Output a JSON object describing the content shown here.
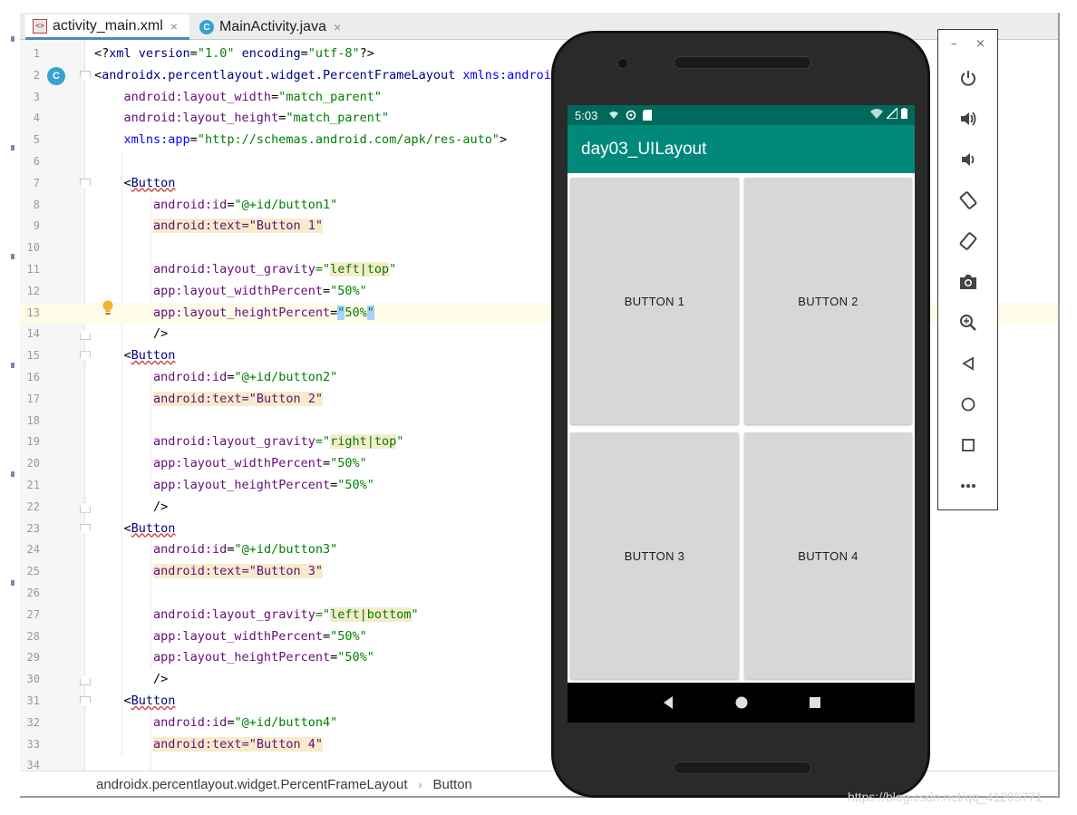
{
  "tabs": [
    {
      "label": "activity_main.xml",
      "icon": "xml-file-icon",
      "active": true
    },
    {
      "label": "MainActivity.java",
      "icon": "java-class-icon",
      "active": false
    }
  ],
  "gutter": {
    "class_marker": "C"
  },
  "code_lines": [
    {
      "n": "1",
      "tokens": [
        {
          "t": "<?",
          "c": "t-punc"
        },
        {
          "t": "xml version",
          "c": "t-tag"
        },
        {
          "t": "=",
          "c": "t-punc"
        },
        {
          "t": "\"1.0\"",
          "c": "t-val"
        },
        {
          "t": " encoding",
          "c": "t-tag"
        },
        {
          "t": "=",
          "c": "t-punc"
        },
        {
          "t": "\"utf-8\"",
          "c": "t-val"
        },
        {
          "t": "?>",
          "c": "t-punc"
        }
      ]
    },
    {
      "n": "2",
      "tokens": [
        {
          "t": "<",
          "c": "t-punc"
        },
        {
          "t": "androidx.percentlayout.widget.PercentFrameLayout",
          "c": "t-tag"
        },
        {
          "t": " xmlns:android",
          "c": "t-attr"
        }
      ]
    },
    {
      "n": "3",
      "tokens": [
        {
          "t": "    android:layout_width",
          "c": "t-attrp"
        },
        {
          "t": "=",
          "c": "t-punc"
        },
        {
          "t": "\"match_parent\"",
          "c": "t-val"
        }
      ]
    },
    {
      "n": "4",
      "tokens": [
        {
          "t": "    android:layout_height",
          "c": "t-attrp"
        },
        {
          "t": "=",
          "c": "t-punc"
        },
        {
          "t": "\"match_parent\"",
          "c": "t-val"
        }
      ]
    },
    {
      "n": "5",
      "tokens": [
        {
          "t": "    xmlns:app",
          "c": "t-attr"
        },
        {
          "t": "=",
          "c": "t-punc"
        },
        {
          "t": "\"http://schemas.android.com/apk/res-auto\"",
          "c": "t-val"
        },
        {
          "t": ">",
          "c": "t-punc"
        }
      ]
    },
    {
      "n": "6",
      "tokens": []
    },
    {
      "n": "7",
      "tokens": [
        {
          "t": "    <",
          "c": "t-punc"
        },
        {
          "t": "Button",
          "c": "t-tag sq"
        }
      ]
    },
    {
      "n": "8",
      "tokens": [
        {
          "t": "        android:id",
          "c": "t-attrp"
        },
        {
          "t": "=",
          "c": "t-punc"
        },
        {
          "t": "\"@+id/button1\"",
          "c": "t-val"
        }
      ]
    },
    {
      "n": "9",
      "tokens": [
        {
          "t": "        ",
          "c": "t-punc"
        },
        {
          "t": "android:text=\"Button 1\"",
          "c": "t-attrp hl"
        }
      ]
    },
    {
      "n": "10",
      "tokens": []
    },
    {
      "n": "11",
      "tokens": [
        {
          "t": "        android:layout_gravity",
          "c": "t-attrp"
        },
        {
          "t": "=\"",
          "c": "t-val"
        },
        {
          "t": "left|top",
          "c": "t-val hl"
        },
        {
          "t": "\"",
          "c": "t-val"
        }
      ]
    },
    {
      "n": "12",
      "tokens": [
        {
          "t": "        app:layout_widthPercent",
          "c": "t-attrp"
        },
        {
          "t": "=",
          "c": "t-punc"
        },
        {
          "t": "\"50%\"",
          "c": "t-val"
        }
      ]
    },
    {
      "n": "13",
      "tokens": [
        {
          "t": "        app:layout_heightPercent",
          "c": "t-attrp"
        },
        {
          "t": "=",
          "c": "t-punc"
        },
        {
          "t": "\"",
          "c": "t-val sel"
        },
        {
          "t": "50%",
          "c": "t-val"
        },
        {
          "t": "\"",
          "c": "t-val sel"
        }
      ],
      "current": true
    },
    {
      "n": "14",
      "tokens": [
        {
          "t": "        />",
          "c": "t-punc"
        }
      ]
    },
    {
      "n": "15",
      "tokens": [
        {
          "t": "    <",
          "c": "t-punc"
        },
        {
          "t": "Button",
          "c": "t-tag sq"
        }
      ]
    },
    {
      "n": "16",
      "tokens": [
        {
          "t": "        android:id",
          "c": "t-attrp"
        },
        {
          "t": "=",
          "c": "t-punc"
        },
        {
          "t": "\"@+id/button2\"",
          "c": "t-val"
        }
      ]
    },
    {
      "n": "17",
      "tokens": [
        {
          "t": "        ",
          "c": "t-punc"
        },
        {
          "t": "android:text=\"Button 2\"",
          "c": "t-attrp hl"
        }
      ]
    },
    {
      "n": "18",
      "tokens": []
    },
    {
      "n": "19",
      "tokens": [
        {
          "t": "        android:layout_gravity",
          "c": "t-attrp"
        },
        {
          "t": "=\"",
          "c": "t-val"
        },
        {
          "t": "right|top",
          "c": "t-val hl"
        },
        {
          "t": "\"",
          "c": "t-val"
        }
      ]
    },
    {
      "n": "20",
      "tokens": [
        {
          "t": "        app:layout_widthPercent",
          "c": "t-attrp"
        },
        {
          "t": "=",
          "c": "t-punc"
        },
        {
          "t": "\"50%\"",
          "c": "t-val"
        }
      ]
    },
    {
      "n": "21",
      "tokens": [
        {
          "t": "        app:layout_heightPercent",
          "c": "t-attrp"
        },
        {
          "t": "=",
          "c": "t-punc"
        },
        {
          "t": "\"50%\"",
          "c": "t-val"
        }
      ]
    },
    {
      "n": "22",
      "tokens": [
        {
          "t": "        />",
          "c": "t-punc"
        }
      ]
    },
    {
      "n": "23",
      "tokens": [
        {
          "t": "    <",
          "c": "t-punc"
        },
        {
          "t": "Button",
          "c": "t-tag sq"
        }
      ]
    },
    {
      "n": "24",
      "tokens": [
        {
          "t": "        android:id",
          "c": "t-attrp"
        },
        {
          "t": "=",
          "c": "t-punc"
        },
        {
          "t": "\"@+id/button3\"",
          "c": "t-val"
        }
      ]
    },
    {
      "n": "25",
      "tokens": [
        {
          "t": "        ",
          "c": "t-punc"
        },
        {
          "t": "android:text=\"Button 3\"",
          "c": "t-attrp hl"
        }
      ]
    },
    {
      "n": "26",
      "tokens": []
    },
    {
      "n": "27",
      "tokens": [
        {
          "t": "        android:layout_gravity",
          "c": "t-attrp"
        },
        {
          "t": "=\"",
          "c": "t-val"
        },
        {
          "t": "left|bottom",
          "c": "t-val hl"
        },
        {
          "t": "\"",
          "c": "t-val"
        }
      ]
    },
    {
      "n": "28",
      "tokens": [
        {
          "t": "        app:layout_widthPercent",
          "c": "t-attrp"
        },
        {
          "t": "=",
          "c": "t-punc"
        },
        {
          "t": "\"50%\"",
          "c": "t-val"
        }
      ]
    },
    {
      "n": "29",
      "tokens": [
        {
          "t": "        app:layout_heightPercent",
          "c": "t-attrp"
        },
        {
          "t": "=",
          "c": "t-punc"
        },
        {
          "t": "\"50%\"",
          "c": "t-val"
        }
      ]
    },
    {
      "n": "30",
      "tokens": [
        {
          "t": "        />",
          "c": "t-punc"
        }
      ]
    },
    {
      "n": "31",
      "tokens": [
        {
          "t": "    <",
          "c": "t-punc"
        },
        {
          "t": "Button",
          "c": "t-tag sq"
        }
      ]
    },
    {
      "n": "32",
      "tokens": [
        {
          "t": "        android:id",
          "c": "t-attrp"
        },
        {
          "t": "=",
          "c": "t-punc"
        },
        {
          "t": "\"@+id/button4\"",
          "c": "t-val"
        }
      ]
    },
    {
      "n": "33",
      "tokens": [
        {
          "t": "        ",
          "c": "t-punc"
        },
        {
          "t": "android:text=\"Button 4\"",
          "c": "t-attrp hl"
        }
      ]
    },
    {
      "n": "34",
      "tokens": []
    }
  ],
  "breadcrumb": {
    "parent": "androidx.percentlayout.widget.PercentFrameLayout",
    "child": "Button"
  },
  "emulator": {
    "status_time": "5:03",
    "app_title": "day03_UILayout",
    "buttons": [
      "BUTTON 1",
      "BUTTON 2",
      "BUTTON 3",
      "BUTTON 4"
    ],
    "colors": {
      "status_bar": "#00695c",
      "app_bar": "#00897b",
      "button": "#d6d7d7"
    }
  },
  "emulator_toolbar": {
    "minimize": "–",
    "close": "×",
    "icons": [
      "power-icon",
      "volume-up-icon",
      "volume-down-icon",
      "rotate-left-icon",
      "rotate-right-icon",
      "camera-icon",
      "zoom-icon",
      "back-icon",
      "home-icon",
      "overview-icon",
      "more-icon"
    ]
  },
  "watermark": "https://blog.csdn.net/qq_41205771"
}
